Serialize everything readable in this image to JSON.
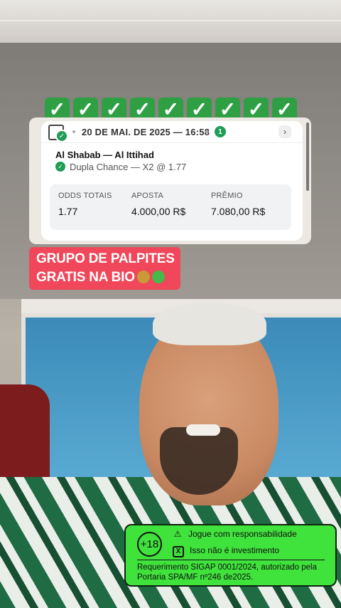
{
  "checks": [
    "✓",
    "✓",
    "✓",
    "✓",
    "✓",
    "✓",
    "✓",
    "✓",
    "✓"
  ],
  "bet_card": {
    "date": "20 DE MAI. DE 2025 — 16:58",
    "selection_count": "1",
    "match": "Al Shabab — Al Ittihad",
    "selection": "Dupla Chance — X2 @ 1.77",
    "stats": [
      {
        "label": "ODDS TOTAIS",
        "value": "1.77"
      },
      {
        "label": "APOSTA",
        "value": "4.000,00 R$"
      },
      {
        "label": "PRÊMIO",
        "value": "7.080,00 R$"
      }
    ]
  },
  "promo": {
    "line1": "GRUPO DE PALPITES",
    "line2": "GRATIS NA BIO",
    "color": "#f0475a"
  },
  "responsible_gambling": {
    "age_badge": "+18",
    "warning": "Jogue com responsabilidade",
    "no_investment": "Isso não é investimento",
    "legal": "Requerimento SIGAP 0001/2024, autorizado pela Portaria SPA/MF nº246 de2025.",
    "color": "#40e23c"
  }
}
